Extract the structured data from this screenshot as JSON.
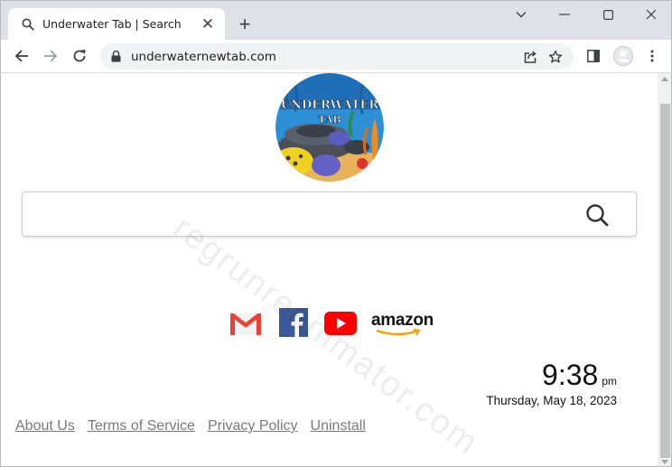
{
  "browser": {
    "tab_title": "Underwater Tab | Search",
    "url": "underwaternewtab.com"
  },
  "logo": {
    "line1": "UNDERWATER",
    "line2": "TAB"
  },
  "search": {
    "placeholder": ""
  },
  "quicklinks": {
    "amazon_label": "amazon"
  },
  "clock": {
    "time": "9:38",
    "ampm": "pm",
    "date": "Thursday, May 18, 2023"
  },
  "footer": {
    "about": "About Us",
    "terms": "Terms of Service",
    "privacy": "Privacy Policy",
    "uninstall": "Uninstall"
  },
  "watermark": "regrunreanimator.com",
  "colors": {
    "gmail_red": "#ea4335",
    "facebook_blue": "#3b5998",
    "youtube_red": "#ff0000",
    "amazon_orange": "#ff9900",
    "footer_link": "#7a7a7a"
  }
}
